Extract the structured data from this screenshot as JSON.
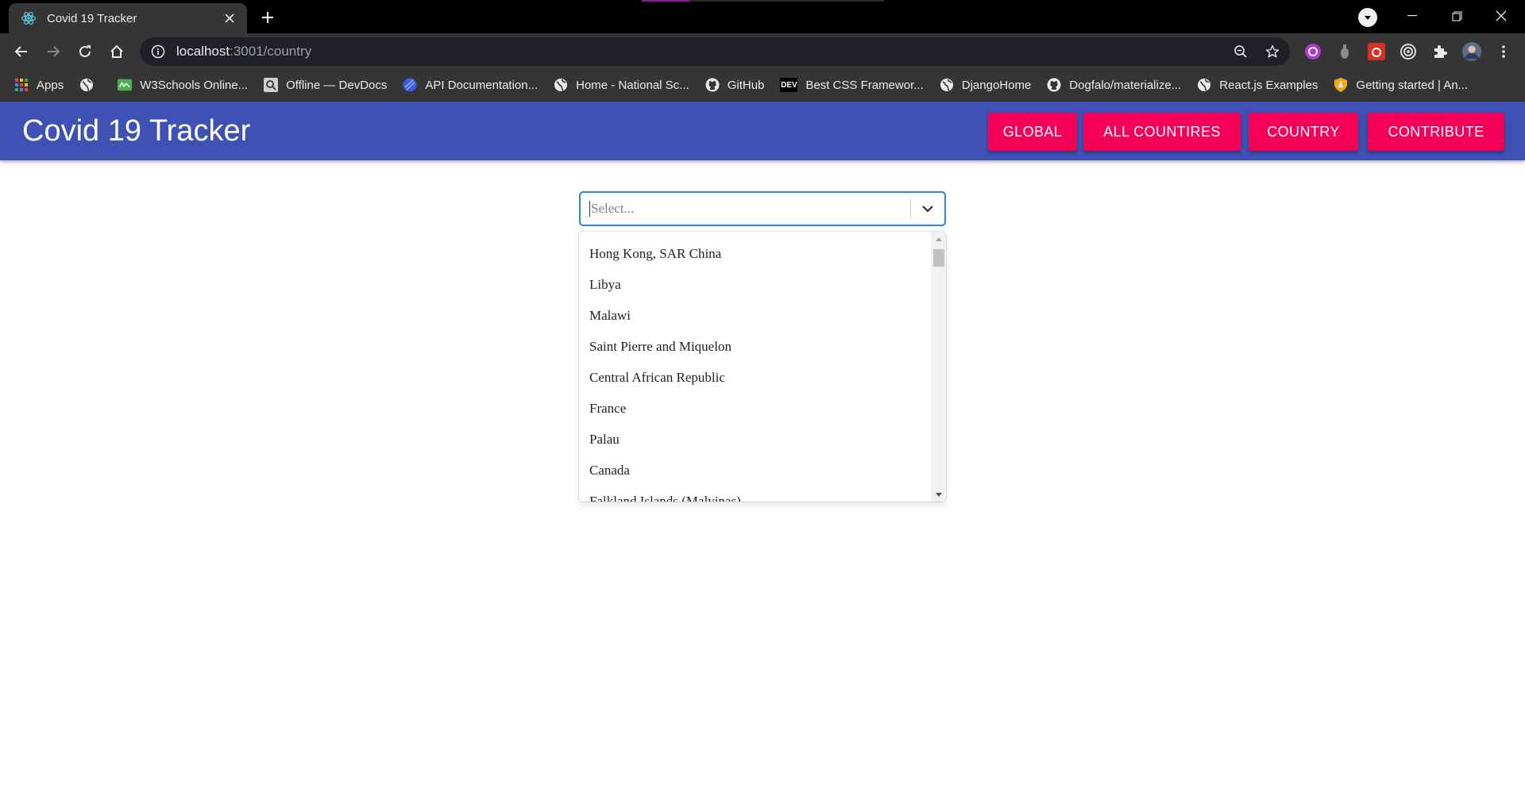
{
  "browser": {
    "tab_title": "Covid 19 Tracker",
    "url_host": "localhost",
    "url_rest": ":3001/country",
    "bookmarks": [
      {
        "label": "Apps",
        "icon": "apps-grid-icon"
      },
      {
        "label": "",
        "icon": "globe-icon"
      },
      {
        "label": "W3Schools Online...",
        "icon": "w3schools-icon"
      },
      {
        "label": "Offline — DevDocs",
        "icon": "devdocs-icon"
      },
      {
        "label": "API Documentation...",
        "icon": "api-doc-icon"
      },
      {
        "label": "Home - National Sc...",
        "icon": "globe-icon"
      },
      {
        "label": "GitHub",
        "icon": "github-icon"
      },
      {
        "label": "Best CSS Framewor...",
        "icon": "dev-icon"
      },
      {
        "label": "DjangoHome",
        "icon": "globe-icon"
      },
      {
        "label": "Dogfalo/materialize...",
        "icon": "github-icon"
      },
      {
        "label": "React.js Examples",
        "icon": "globe-icon"
      },
      {
        "label": "Getting started | An...",
        "icon": "shield-icon"
      }
    ],
    "dev_badge": "DEV"
  },
  "header": {
    "title": "Covid 19 Tracker",
    "nav": [
      {
        "label": "GLOBAL"
      },
      {
        "label": "ALL COUNTIRES"
      },
      {
        "label": "COUNTRY"
      },
      {
        "label": "CONTRIBUTE"
      }
    ]
  },
  "select": {
    "placeholder": "Select...",
    "options": [
      "Hong Kong, SAR China",
      "Libya",
      "Malawi",
      "Saint Pierre and Miquelon",
      "Central African Republic",
      "France",
      "Palau",
      "Canada",
      "Falkland Islands (Malvinas)"
    ]
  },
  "colors": {
    "appbar": "#3f51b5",
    "button": "#f50057",
    "focus_border": "#2684ff"
  }
}
